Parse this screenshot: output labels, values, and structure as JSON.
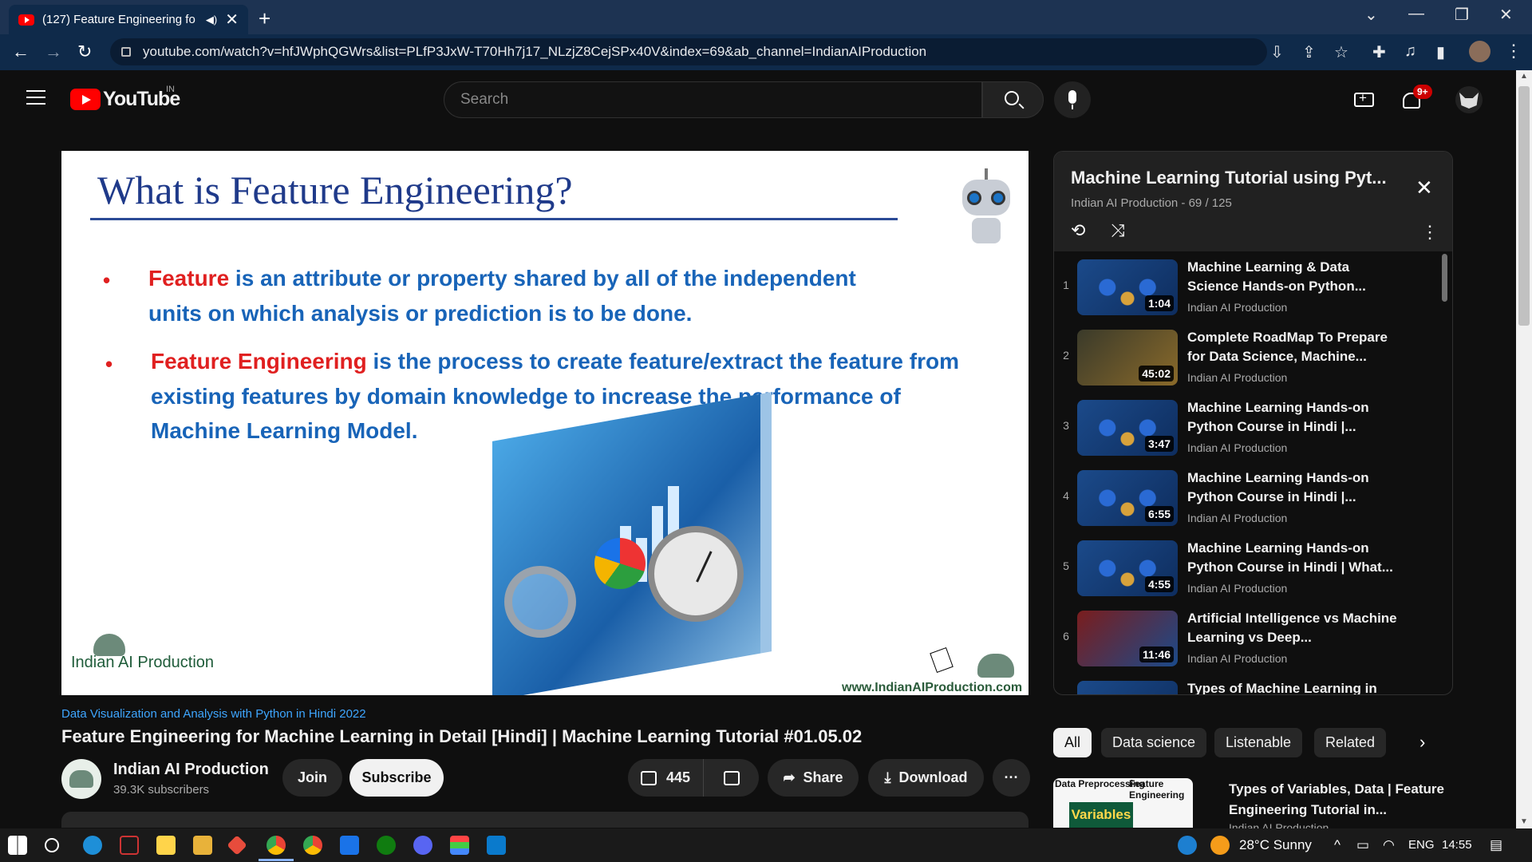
{
  "browser": {
    "tab_title": "(127) Feature Engineering fo",
    "tab_audio": "◀)",
    "tab_close": "✕",
    "new_tab": "+",
    "url": "youtube.com/watch?v=hfJWphQGWrs&list=PLfP3JxW-T70Hh7j17_NLzjZ8CejSPx40V&index=69&ab_channel=IndianAIProduction",
    "win_dropdown": "⌄",
    "win_minimize": "—",
    "win_restore": "❐",
    "win_close": "✕",
    "back": "←",
    "forward": "→",
    "reload": "↻",
    "menu": "⋮"
  },
  "header": {
    "logo_text": "YouTube",
    "country": "IN",
    "search_placeholder": "Search",
    "notifications_badge": "9+"
  },
  "slide": {
    "title": "What is Feature Engineering?",
    "bullet1_highlight": "Feature",
    "bullet1_line1": " is an attribute or property shared by all of the independent",
    "bullet1_line2": "units on which analysis or prediction is to be done.",
    "bullet2_highlight": "Feature Engineering",
    "bullet2_line1": " is the process to create feature/extract the feature from",
    "bullet2_line2": "existing features by domain knowledge to increase the performance of",
    "bullet2_line3": "Machine Learning Model.",
    "bullet_mark": "•",
    "brand_left": "Indian AI Production",
    "brand_right": "www.IndianAIProduction.com"
  },
  "video": {
    "playlist_link": "Data Visualization and Analysis with Python in Hindi 2022",
    "title": "Feature Engineering for Machine Learning in Detail [Hindi] | Machine Learning Tutorial #01.05.02",
    "channel_name": "Indian AI Production",
    "subscribers": "39.3K subscribers",
    "join_label": "Join",
    "subscribe_label": "Subscribe",
    "likes": "445",
    "share_label": "Share",
    "download_label": "Download",
    "more": "···"
  },
  "playlist": {
    "title": "Machine Learning Tutorial using Pyt...",
    "subtitle": "Indian AI Production - 69 / 125",
    "close": "✕",
    "loop": "⟲",
    "shuffle": "⤨",
    "more": "⋮",
    "items": [
      {
        "index": "1",
        "title": "Machine Learning & Data Science Hands-on Python...",
        "channel": "Indian AI Production",
        "duration": "1:04"
      },
      {
        "index": "2",
        "title": "Complete RoadMap To Prepare for Data Science, Machine...",
        "channel": "Indian AI Production",
        "duration": "45:02"
      },
      {
        "index": "3",
        "title": "Machine Learning Hands-on Python Course in Hindi |...",
        "channel": "Indian AI Production",
        "duration": "3:47"
      },
      {
        "index": "4",
        "title": "Machine Learning Hands-on Python Course in Hindi |...",
        "channel": "Indian AI Production",
        "duration": "6:55"
      },
      {
        "index": "5",
        "title": "Machine Learning Hands-on Python Course in Hindi | What...",
        "channel": "Indian AI Production",
        "duration": "4:55"
      },
      {
        "index": "6",
        "title": "Artificial Intelligence vs Machine Learning vs Deep...",
        "channel": "Indian AI Production",
        "duration": "11:46"
      },
      {
        "index": "7",
        "title": "Types of Machine Learning in",
        "channel": "",
        "duration": ""
      }
    ]
  },
  "chips": [
    "All",
    "Data science",
    "Listenable",
    "Related"
  ],
  "chip_next": "›",
  "recommended": {
    "title": "Types of Variables, Data | Feature Engineering Tutorial in...",
    "channel": "Indian AI Production",
    "thumb_text1": "Data Preprocessing",
    "thumb_text2": "Feature Engineering",
    "thumb_tag": "Variables"
  },
  "taskbar": {
    "weather": "28°C  Sunny",
    "language": "ENG",
    "time": "14:55",
    "tray_up": "^"
  },
  "colors": {
    "accent_red": "#ff0000",
    "link_blue": "#3ea6ff",
    "slide_title": "#1f3a8a",
    "slide_text": "#1864b8",
    "slide_highlight": "#e02020"
  }
}
